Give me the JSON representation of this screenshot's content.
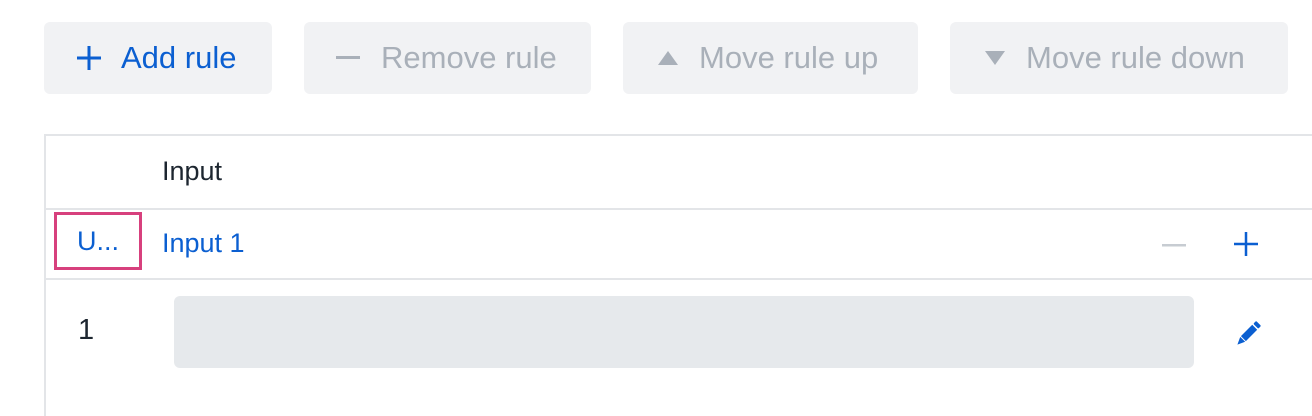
{
  "toolbar": {
    "add_rule": "Add rule",
    "remove_rule": "Remove rule",
    "move_rule_up": "Move rule up",
    "move_rule_down": "Move rule down"
  },
  "table": {
    "header_input": "Input",
    "uid_label": "U...",
    "input_name": "Input 1",
    "rules": [
      {
        "index": "1",
        "entry": ""
      }
    ]
  },
  "icons": {
    "add": "plus-icon",
    "remove": "minus-icon",
    "up": "triangle-up-icon",
    "down": "triangle-down-icon",
    "edit": "pencil-icon"
  },
  "colors": {
    "accent": "#0b5fd1",
    "disabled": "#a9b0b9",
    "highlight": "#d7407d",
    "button_bg": "#f1f2f4",
    "entry_bg": "#e6e9ec"
  }
}
